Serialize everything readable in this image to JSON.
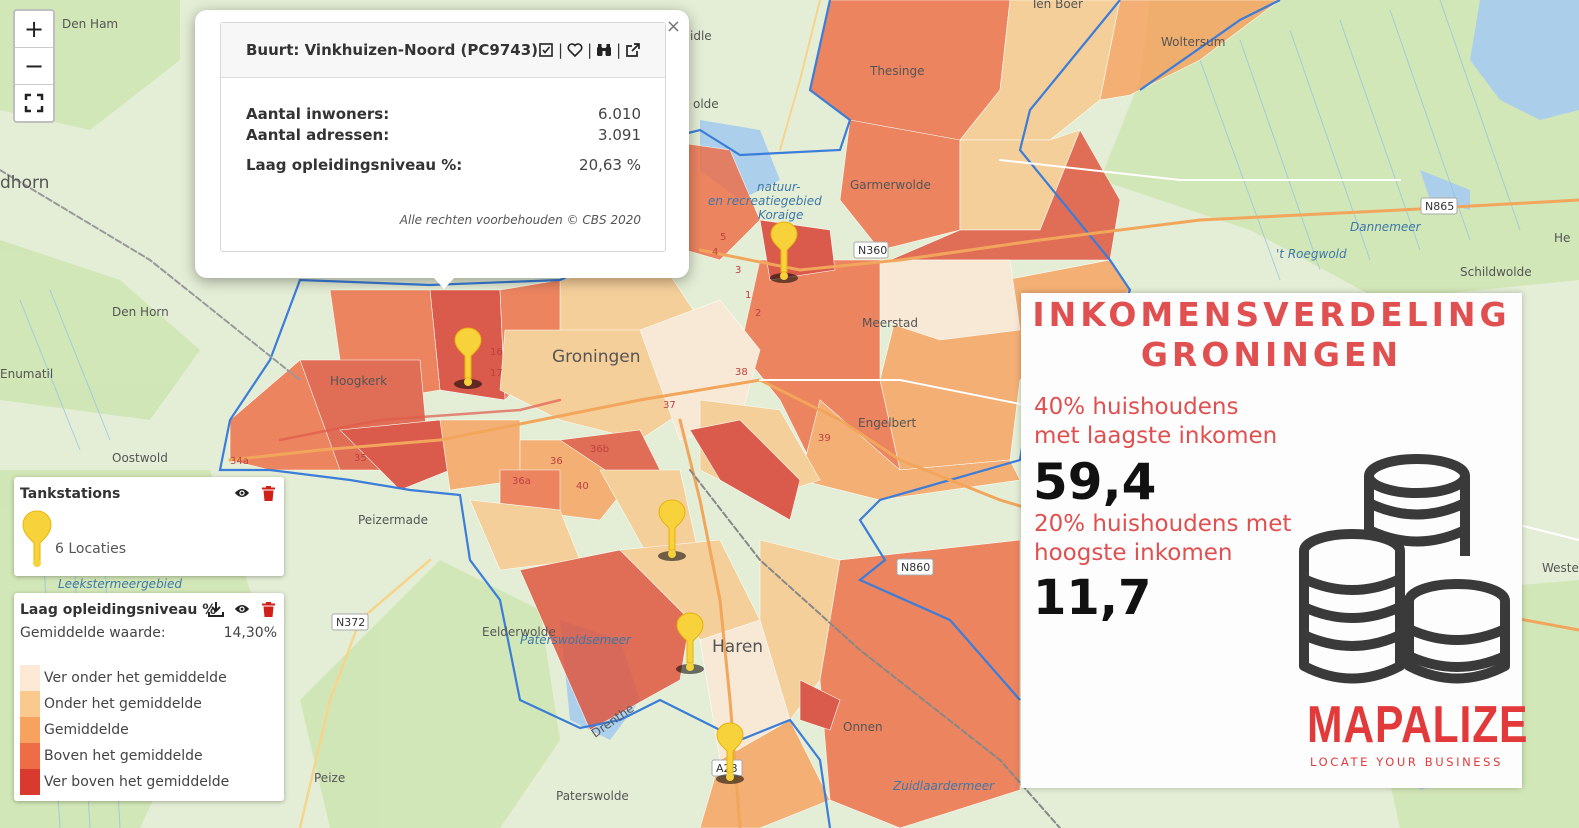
{
  "zoom": {
    "in_label": "+",
    "out_label": "−"
  },
  "popup": {
    "title": "Buurt: Vinkhuizen-Noord (PC9743)",
    "rows": [
      {
        "label": "Aantal inwoners:",
        "value": "6.010"
      },
      {
        "label": "Aantal adressen:",
        "value": "3.091"
      },
      {
        "label": "Laag opleidingsniveau %:",
        "value": "20,63 %"
      }
    ],
    "footer": "Alle rechten voorbehouden © CBS 2020",
    "close": "×"
  },
  "tankstations": {
    "title": "Tankstations",
    "count_label": "6 Locaties"
  },
  "education_legend": {
    "title": "Laag opleidingsniveau %",
    "avg_label": "Gemiddelde waarde:",
    "avg_value": "14,30%",
    "classes": [
      {
        "label": "Ver onder het gemiddelde",
        "color": "#fde9d6"
      },
      {
        "label": "Onder het gemiddelde",
        "color": "#f9c98e"
      },
      {
        "label": "Gemiddelde",
        "color": "#f7a25f"
      },
      {
        "label": "Boven het gemiddelde",
        "color": "#ee6d47"
      },
      {
        "label": "Ver boven het gemiddelde",
        "color": "#d83a2d"
      }
    ]
  },
  "info_card": {
    "title_line1": "INKOMENSVERDELING",
    "title_line2": "GRONINGEN",
    "low_label_line1": "40% huishoudens",
    "low_label_line2": "met laagste inkomen",
    "low_value": "59,4",
    "high_label_line1": "20% huishoudens met",
    "high_label_line2": "hoogste inkomen",
    "high_value": "11,7",
    "brand_name": "MAPALIZE",
    "brand_tagline": "LOCATE YOUR BUSINESS"
  },
  "map_labels": {
    "den_ham": "Den Ham",
    "dhorn": "dhorn",
    "den_horn": "Den Horn",
    "enumatil": "Enumatil",
    "oostwold": "Oostwold",
    "hoogkerk": "Hoogkerk",
    "groningen": "Groningen",
    "peizermade": "Peizermade",
    "leekstermeergebied": "Leekstermeergebied",
    "eelderwolde": "Eelderwolde",
    "paterswoldsemeer": "Paterswoldsemeer",
    "peize": "Peize",
    "paterswolde": "Paterswolde",
    "haren": "Haren",
    "onnen": "Onnen",
    "zuidlaardermeer": "Zuidlaardermeer",
    "drenthe": "Drenthe",
    "thesinge": "Thesinge",
    "ten_boer": "Ten Boer",
    "woltersum": "Woltersum",
    "garmerwolde": "Garmerwolde",
    "meerstad": "Meerstad",
    "engelbert": "Engelbert",
    "dannemeer": "Dannemeer",
    "roegwold": "'t Roegwold",
    "schildwolde": "Schildwolde",
    "westerbroek": "Weste",
    "he": "He",
    "idle": "idle",
    "olde": "olde",
    "natuur": "natuur-",
    "recreatiegebied": "en recreatiegebied",
    "koraige": "Koraige",
    "roads": [
      "N360",
      "N865",
      "N860",
      "N372",
      "A28",
      "38",
      "37",
      "36",
      "36b",
      "36a",
      "35",
      "34a",
      "17",
      "16",
      "40",
      "39",
      "1",
      "2",
      "3",
      "4",
      "5"
    ]
  }
}
